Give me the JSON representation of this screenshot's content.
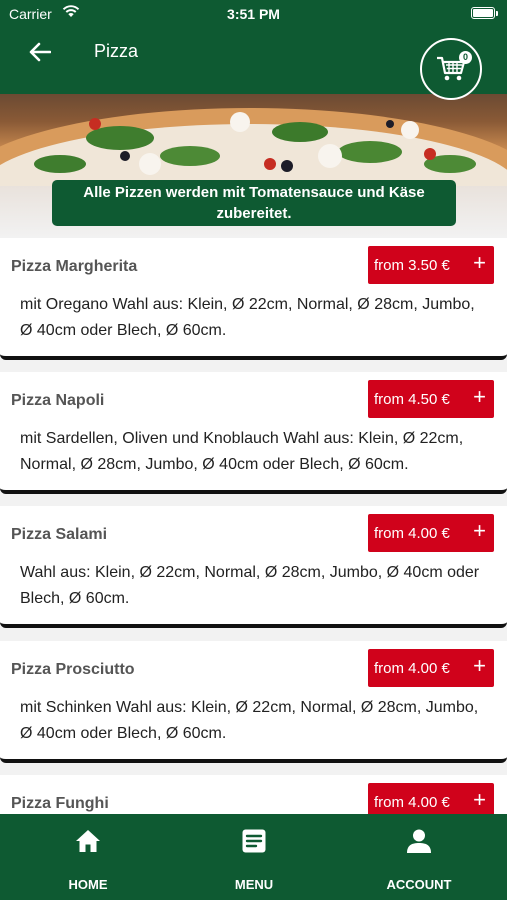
{
  "status": {
    "carrier": "Carrier",
    "time": "3:51 PM"
  },
  "header": {
    "title": "Pizza",
    "cart_count": "0"
  },
  "banner": {
    "line1": "Alle Pizzen werden mit Tomatensauce und Käse",
    "line2": "zubereitet."
  },
  "items": [
    {
      "name": "Pizza Margherita",
      "price": "from 3.50 €",
      "desc_line1": "mit Oregano  Wahl aus: Klein, Ø 22cm, Normal, Ø 28cm, Jumbo,",
      "desc_line2": "Ø 40cm oder Blech, Ø 60cm."
    },
    {
      "name": "Pizza Napoli",
      "price": "from 4.50 €",
      "desc_line1": "mit Sardellen, Oliven und Knoblauch  Wahl aus: Klein, Ø 22cm,",
      "desc_line2": "Normal, Ø 28cm, Jumbo, Ø 40cm oder Blech, Ø 60cm."
    },
    {
      "name": "Pizza Salami",
      "price": "from 4.00 €",
      "desc_line1": "Wahl aus: Klein, Ø 22cm, Normal, Ø 28cm, Jumbo, Ø 40cm oder",
      "desc_line2": "Blech, Ø 60cm."
    },
    {
      "name": "Pizza Prosciutto",
      "price": "from 4.00 €",
      "desc_line1": "mit Schinken  Wahl aus: Klein, Ø 22cm, Normal, Ø 28cm, Jumbo,",
      "desc_line2": "Ø 40cm oder Blech, Ø 60cm."
    },
    {
      "name": "Pizza Funghi",
      "price": "from 4.00 €",
      "desc_line1": "",
      "desc_line2": ""
    }
  ],
  "nav": {
    "home": "HOME",
    "menu": "MENU",
    "account": "ACCOUNT"
  },
  "colors": {
    "brand": "#0e5a32",
    "price_button": "#d0021b"
  },
  "icons": {
    "back": "arrow-left-icon",
    "cart": "cart-icon",
    "home": "home-icon",
    "menu": "menu-list-icon",
    "account": "user-icon"
  }
}
